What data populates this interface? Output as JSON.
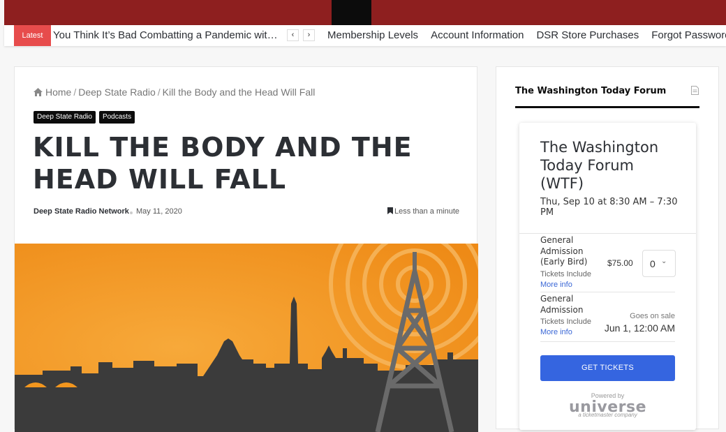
{
  "nav": {
    "latest_label": "Latest",
    "ticker_text": "You Think It’s Bad Combatting a Pandemic with L...",
    "links": [
      {
        "label": "Membership Levels"
      },
      {
        "label": "Account Information"
      },
      {
        "label": "DSR Store Purchases"
      },
      {
        "label": "Forgot Password?"
      }
    ]
  },
  "article": {
    "breadcrumb": {
      "home": "Home",
      "section": "Deep State Radio",
      "current": "Kill the Body and the Head Will Fall"
    },
    "categories": [
      "Deep State Radio",
      "Podcasts"
    ],
    "title": "KILL THE BODY AND THE HEAD WILL FALL",
    "author": "Deep State Radio Network",
    "date": "May 11, 2020",
    "read_time": "Less than a minute"
  },
  "sidebar": {
    "widget_title": "The Washington Today Forum",
    "event": {
      "name": "The Washington Today Forum (WTF)",
      "datetime": "Thu, Sep 10 at 8:30 AM – 7:30 PM"
    },
    "tiers": [
      {
        "name": "General Admission (Early Bird)",
        "includes": "Tickets Include",
        "more": "More info",
        "price": "$75.00",
        "qty": "0"
      },
      {
        "name": "General Admission",
        "includes": "Tickets Include",
        "more": "More info",
        "sale_label": "Goes on sale",
        "sale_date": "Jun 1, 12:00 AM"
      }
    ],
    "button_label": "GET TICKETS",
    "powered_by": "Powered by",
    "brand": "universe",
    "brand_sub": "a ticketmaster company"
  },
  "colors": {
    "header_red": "#8e1f1f",
    "latest_red": "#e74c4c",
    "accent_blue": "#3565e0",
    "hero_orange": "#f2961e"
  }
}
